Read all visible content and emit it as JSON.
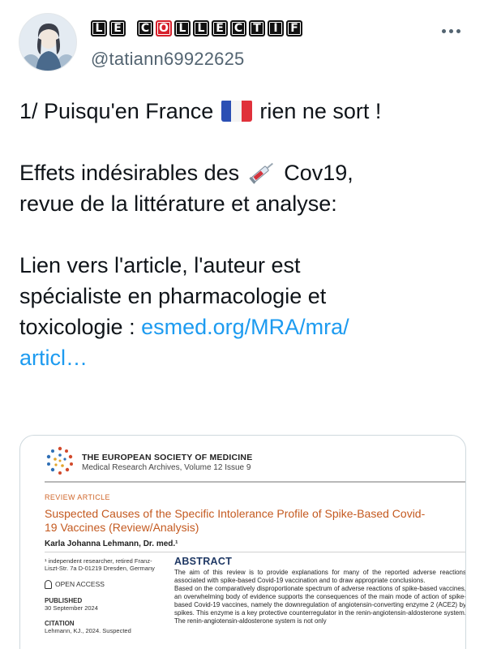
{
  "author": {
    "display_name_letters": [
      "L",
      "E",
      " ",
      "C",
      "O",
      "L",
      "L",
      "E",
      "C",
      "T",
      "I",
      "F"
    ],
    "display_name": "LE COLLECTIF",
    "handle": "@tatiann69922625"
  },
  "tweet": {
    "line1_before_flag": "1/ Puisqu'en France",
    "line1_after_flag": "rien ne sort !",
    "line2_before_emoji": "Effets indésirables des",
    "line2_after_emoji": "Cov19,",
    "line3": "revue de la littérature et analyse:",
    "line4": "Lien vers l'article, l'auteur est",
    "line5": "spécialiste en pharmacologie et",
    "line6_text": "toxicologie :",
    "link_part1": "esmed.org/MRA/mra/",
    "link_part2": "articl…"
  },
  "colors": {
    "link": "#1d9bf0",
    "secondary_text": "#536471",
    "article_orange": "#c45a20",
    "abstract_blue": "#1f3864"
  },
  "icons": {
    "more": "more-horizontal-icon",
    "flag": "france-flag-icon",
    "syringe": "syringe-icon"
  },
  "media": {
    "society": "THE EUROPEAN SOCIETY OF MEDICINE",
    "journal": "Medical Research Archives, Volume 12 Issue 9",
    "review_tag": "REVIEW ARTICLE",
    "title": "Suspected Causes of the Specific Intolerance Profile of Spike-Based Covid-19 Vaccines (Review/Analysis)",
    "article_author": "Karla Johanna Lehmann, Dr. med.¹",
    "affiliation": "¹ independent researcher, retired Franz-Liszt-Str. 7a  D-01219 Dresden, Germany",
    "open_access": "OPEN ACCESS",
    "published_label": "PUBLISHED",
    "published_date": "30 September 2024",
    "citation_label": "CITATION",
    "citation_text": "Lehmann, KJ., 2024. Suspected",
    "abstract_heading": "ABSTRACT",
    "abstract_p1": "The aim of this review is to provide explanations for many of the reported adverse reactions associated with spike-based Covid-19 vaccination and to draw appropriate conclusions.",
    "abstract_p2": "Based on the comparatively disproportionate spectrum of adverse reactions of spike-based vaccines, an overwhelming body of evidence supports the consequences of the main mode of action of spike-based Covid-19 vaccines, namely the downregulation of angiotensin-converting enzyme 2 (ACE2) by spikes. This enzyme is a key protective counterregulator in the renin-angiotensin-aldosterone system. The renin-angiotensin-aldosterone system is not only"
  }
}
